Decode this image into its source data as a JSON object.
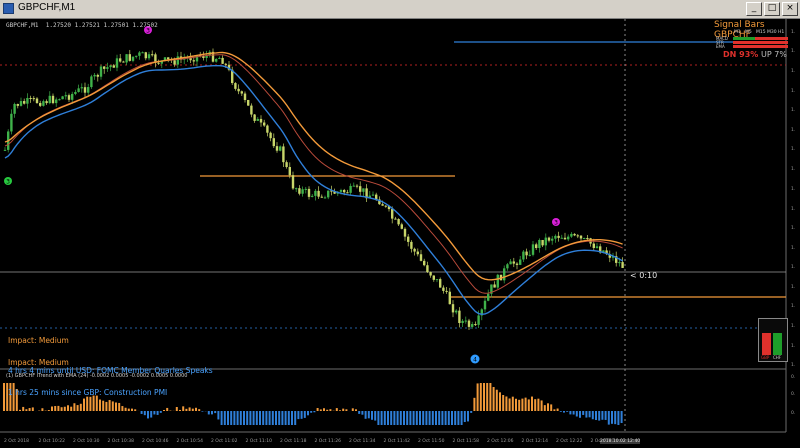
{
  "window": {
    "title": "GBPCHF,M1",
    "symbol_line": "GBPCHF,M1  1.27520 1.27521 1.27501 1.27502"
  },
  "news": {
    "impact1": "Impact: Medium",
    "text1": "4 hrs 4 mins until USD: FOMC Member Quarles Speaks",
    "impact2": "Impact: Medium",
    "text2": "1 hrs 25 mins since GBP: Construction PMI"
  },
  "signal_bars": {
    "title": "Signal Bars GBPCHF",
    "timeframes": [
      "M1",
      "M5",
      "M15",
      "M30",
      "H1"
    ],
    "rows": [
      "MACD",
      "STR",
      "EMA"
    ],
    "dn_label": "DN 93%",
    "up_label": "UP 7%",
    "colors": {
      "up": "#1e9e2a",
      "down": "#e0312c",
      "title": "#f29a3a"
    }
  },
  "chart": {
    "countdown": "< 0:10",
    "markers": [
      "3",
      "3",
      "3",
      "4"
    ],
    "sub_indicator": "(1) GBPCHF ITrend with EMA (24) -0.0002 0.0005 -0.0002 0.0005 0.0000",
    "time_labels": [
      "2 Oct 2018",
      "2 Oct 10:22",
      "2 Oct 10:30",
      "2 Oct 10:38",
      "2 Oct 10:46",
      "2 Oct 10:54",
      "2 Oct 11:02",
      "2 Oct 11:10",
      "2 Oct 11:18",
      "2 Oct 11:26",
      "2 Oct 11:34",
      "2 Oct 11:42",
      "2 Oct 11:50",
      "2 Oct 11:58",
      "2 Oct 12:06",
      "2 Oct 12:14",
      "2 Oct 12:22",
      "2 Oct 12:3",
      "2018.10.02 12:40"
    ],
    "colors": {
      "bull": "#3fb24a",
      "bear": "#c8d66a",
      "ema_fast": "#2f7fd9",
      "ema_slow": "#f29a3a",
      "ema_mid": "#b84a3a",
      "hist_pos": "#f29a3a",
      "hist_neg": "#2f7fd9"
    }
  }
}
